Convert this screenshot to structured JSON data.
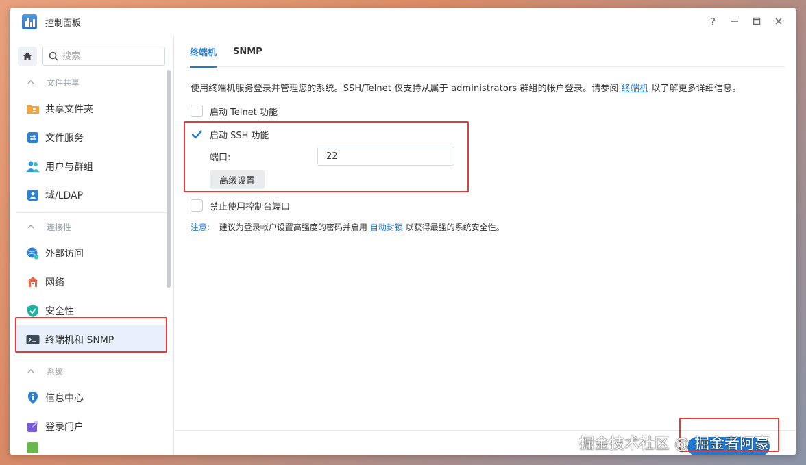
{
  "window": {
    "title": "控制面板",
    "controls": {
      "help": "?",
      "minimize": "—",
      "maximize": "□",
      "close": "✕"
    }
  },
  "sidebar": {
    "search_placeholder": "搜索",
    "sections": [
      {
        "label": "文件共享",
        "items": [
          {
            "label": "共享文件夹",
            "icon": "folder-share-icon"
          },
          {
            "label": "文件服务",
            "icon": "file-services-icon"
          },
          {
            "label": "用户与群组",
            "icon": "users-icon"
          },
          {
            "label": "域/LDAP",
            "icon": "domain-ldap-icon"
          }
        ]
      },
      {
        "label": "连接性",
        "items": [
          {
            "label": "外部访问",
            "icon": "external-access-icon"
          },
          {
            "label": "网络",
            "icon": "network-icon"
          },
          {
            "label": "安全性",
            "icon": "security-shield-icon"
          },
          {
            "label": "终端机和 SNMP",
            "icon": "terminal-icon",
            "active": true
          }
        ]
      },
      {
        "label": "系统",
        "items": [
          {
            "label": "信息中心",
            "icon": "info-center-icon"
          },
          {
            "label": "登录门户",
            "icon": "login-portal-icon"
          }
        ]
      }
    ]
  },
  "tabs": [
    {
      "label": "终端机",
      "active": true
    },
    {
      "label": "SNMP",
      "active": false
    }
  ],
  "terminal": {
    "description_pre": "使用终端机服务登录并管理您的系统。SSH/Telnet 仅支持从属于 administrators 群组的帐户登录。请参阅",
    "description_link": "终端机",
    "description_post": "以了解更多详细信息。",
    "telnet_label": "启动 Telnet 功能",
    "telnet_checked": false,
    "ssh_label": "启动 SSH 功能",
    "ssh_checked": true,
    "port_label": "端口:",
    "port_value": "22",
    "advanced_button": "高级设置",
    "console_label": "禁止使用控制台端口",
    "console_checked": false,
    "note_label": "注意:",
    "note_pre": "建议为登录帐户设置高强度的密码并启用",
    "note_link": "自动封锁",
    "note_post": "以获得最强的系统安全性。"
  },
  "watermark": "掘金技术社区 @ 掘金者阿豪",
  "colors": {
    "accent": "#1f7ad6",
    "highlight_box": "#e33b36",
    "active_item_bg": "#e8f1fb"
  }
}
